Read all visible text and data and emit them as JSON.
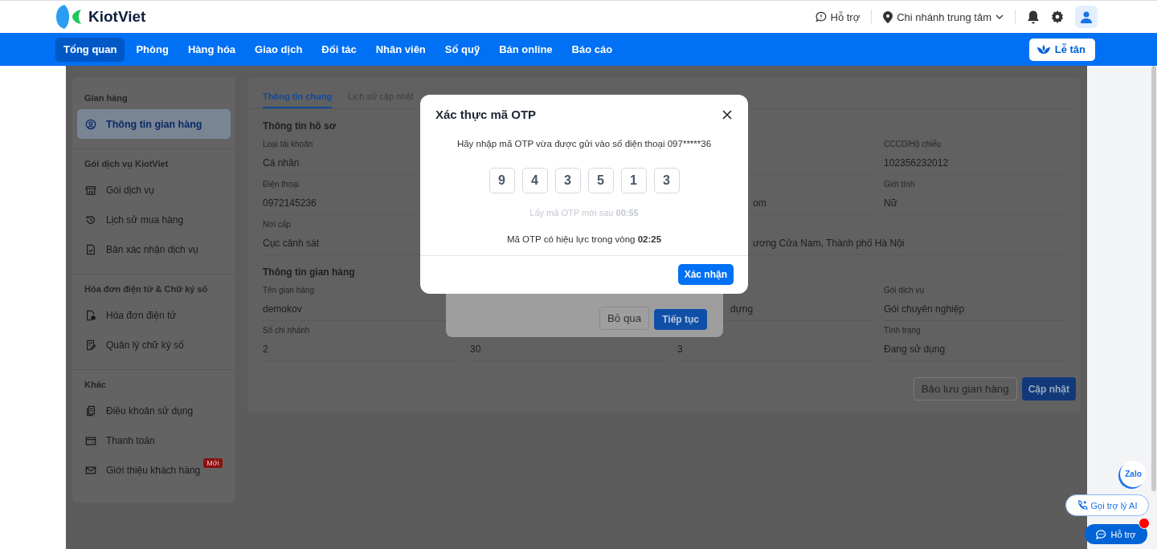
{
  "header": {
    "logo_text": "KiotViet",
    "support_label": "Hỗ trợ",
    "branch": "Chi nhánh trung tâm"
  },
  "nav": {
    "items": [
      {
        "label": "Tổng quan",
        "selected": true
      },
      {
        "label": "Phòng",
        "selected": false
      },
      {
        "label": "Hàng hóa",
        "selected": false
      },
      {
        "label": "Giao dịch",
        "selected": false
      },
      {
        "label": "Đối tác",
        "selected": false
      },
      {
        "label": "Nhân viên",
        "selected": false
      },
      {
        "label": "Sổ quỹ",
        "selected": false
      },
      {
        "label": "Bán online",
        "selected": false
      },
      {
        "label": "Báo cáo",
        "selected": false
      }
    ],
    "reception_button": "Lễ tân"
  },
  "sidebar": {
    "sections": [
      {
        "title": "Gian hàng",
        "items": [
          {
            "label": "Thông tin gian hàng",
            "selected": true
          }
        ]
      },
      {
        "title": "Gói dịch vụ KiotViet",
        "items": [
          {
            "label": "Gói dịch vụ",
            "selected": false
          },
          {
            "label": "Lịch sử mua hàng",
            "selected": false
          },
          {
            "label": "Bản xác nhận dịch vụ",
            "selected": false
          }
        ]
      },
      {
        "title": "Hóa đơn điện tử & Chữ ký số",
        "items": [
          {
            "label": "Hóa đơn điện tử",
            "selected": false
          },
          {
            "label": "Quản lý chữ ký số",
            "selected": false
          }
        ]
      },
      {
        "title": "Khác",
        "items": [
          {
            "label": "Điều khoản sử dụng",
            "selected": false
          },
          {
            "label": "Thanh toán",
            "selected": false
          },
          {
            "label": "Giới thiệu khách hàng",
            "selected": false,
            "badge": "Mới"
          }
        ]
      }
    ]
  },
  "tabs": [
    {
      "label": "Thông tin chung",
      "selected": true
    },
    {
      "label": "Lịch sử cập nhật",
      "selected": false
    }
  ],
  "profile": {
    "title": "Thông tin hồ sơ",
    "rows": [
      [
        {
          "kind": "field",
          "label": "Loại tài khoản",
          "value": "Cá nhân"
        },
        {
          "kind": "covered"
        },
        {
          "kind": "covered"
        },
        {
          "kind": "field",
          "label": "CCCD/Hộ chiếu",
          "value": "102356232012"
        }
      ],
      [
        {
          "kind": "field",
          "label": "Điện thoại",
          "value": "0972145236"
        },
        {
          "kind": "covered"
        },
        {
          "kind": "tail",
          "value": "om"
        },
        {
          "kind": "field",
          "label": "Giới tính",
          "value": "Nữ"
        }
      ],
      [
        {
          "kind": "field",
          "label": "Nơi cấp",
          "value": "Cục cảnh sát"
        },
        {
          "kind": "covered"
        },
        {
          "kind": "tail",
          "value": "ương Cửa Nam, Thành phố Hà Nội"
        }
      ]
    ]
  },
  "store": {
    "title": "Thông tin gian hàng",
    "rows": [
      [
        {
          "kind": "field",
          "label": "Tên gian hàng",
          "value": "demokov"
        },
        {
          "kind": "covered"
        },
        {
          "kind": "tail-short",
          "value": "dựng"
        },
        {
          "kind": "field",
          "label": "Gói dịch vụ",
          "value": "Gói chuyên nghiệp"
        }
      ],
      [
        {
          "kind": "field",
          "label": "Số chi nhánh",
          "value": "2"
        },
        {
          "kind": "field",
          "value": "30"
        },
        {
          "kind": "field",
          "value": "3"
        },
        {
          "kind": "field",
          "label": "Tình trạng",
          "value": "Đang sử dụng"
        }
      ]
    ]
  },
  "actions": [
    "Bảo lưu gian hàng",
    "Cập nhật"
  ],
  "back_dialog": {
    "buttons": [
      "Bỏ qua",
      "Tiếp tục"
    ]
  },
  "otp_dialog": {
    "title": "Xác thực mã OTP",
    "message": "Hãy nhập mã OTP vừa được gửi vào số điện thoại 097*****36",
    "digits": [
      "9",
      "4",
      "3",
      "5",
      "1",
      "3"
    ],
    "resend": "Lấy mã OTP mới sau **00:55**",
    "validity": "Mã OTP có hiệu lực trong vòng **02:25**",
    "confirm": "Xác nhận"
  },
  "floating": {
    "zalo": "Zalo",
    "ai_call": "Gọi trợ lý AI",
    "support": "Hỗ trợ",
    "support_alert": true
  }
}
